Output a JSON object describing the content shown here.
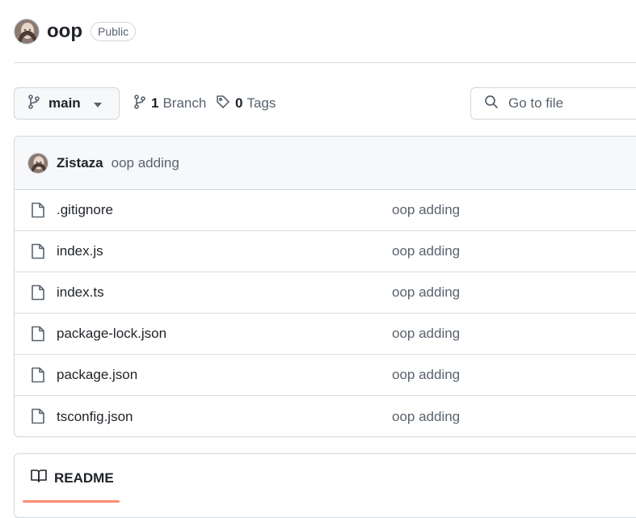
{
  "repo": {
    "name": "oop",
    "visibility": "Public"
  },
  "toolbar": {
    "branch": "main",
    "branch_count": "1",
    "branch_label": "Branch",
    "tag_count": "0",
    "tag_label": "Tags",
    "goto_placeholder": "Go to file"
  },
  "commit": {
    "author": "Zistaza",
    "message": "oop adding"
  },
  "files": [
    {
      "name": ".gitignore",
      "commit": "oop adding"
    },
    {
      "name": "index.js",
      "commit": "oop adding"
    },
    {
      "name": "index.ts",
      "commit": "oop adding"
    },
    {
      "name": "package-lock.json",
      "commit": "oop adding"
    },
    {
      "name": "package.json",
      "commit": "oop adding"
    },
    {
      "name": "tsconfig.json",
      "commit": "oop adding"
    }
  ],
  "readme": {
    "tab_label": "README"
  },
  "colors": {
    "accent_underline": "#fd8c73",
    "border": "#d0d7de",
    "muted_text": "#59636e"
  },
  "icons": {
    "branch": "git-branch-icon",
    "tag": "tag-icon",
    "search": "search-icon",
    "file": "file-icon",
    "book": "book-icon",
    "caret": "triangle-down-icon"
  }
}
